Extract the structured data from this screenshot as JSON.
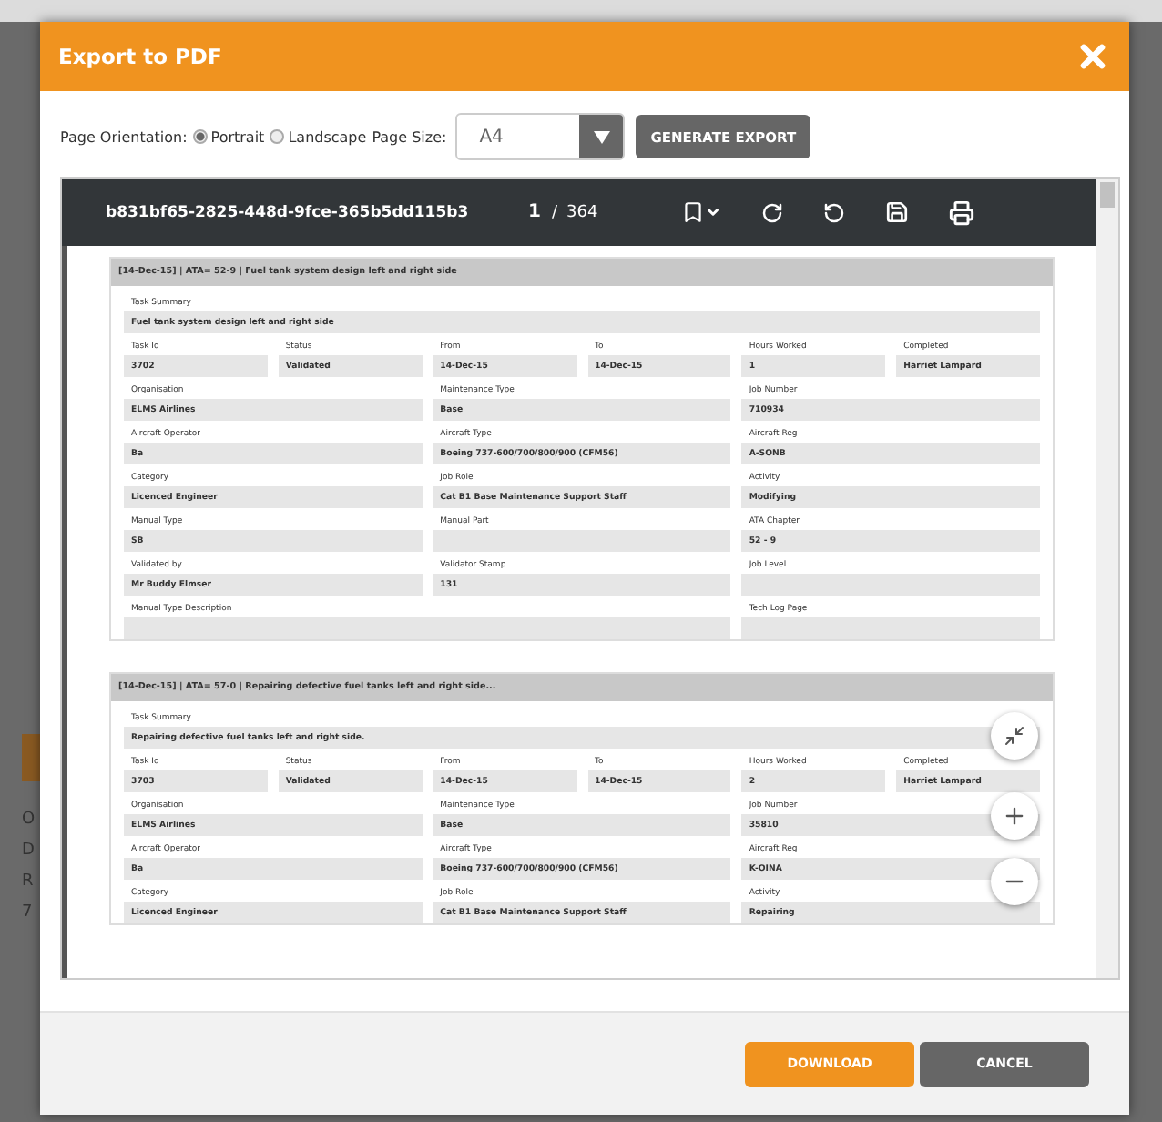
{
  "background_fragments": [
    "O",
    "D",
    "R",
    "7"
  ],
  "dialog": {
    "title": "Export to PDF"
  },
  "options": {
    "orientation_label": "Page Orientation:",
    "orientations": [
      {
        "label": "Portrait",
        "selected": true
      },
      {
        "label": "Landscape",
        "selected": false
      }
    ],
    "page_size_label": "Page Size:",
    "page_size": "A4",
    "generate_button": "GENERATE EXPORT"
  },
  "viewer": {
    "document_title": "b831bf65-2825-448d-9fce-365b5dd115b3",
    "page": "1",
    "separator": "/",
    "page_count": "364"
  },
  "records": [
    {
      "header": "[14-Dec-15] | ATA= 52-9 | Fuel tank system design left and right side",
      "rows": [
        {
          "kind": "full",
          "fields": [
            {
              "label": "Task Summary",
              "value": "Fuel tank system design left and right side"
            }
          ]
        },
        {
          "kind": "six",
          "fields": [
            {
              "label": "Task Id",
              "value": "3702"
            },
            {
              "label": "Status",
              "value": "Validated"
            },
            {
              "label": "From",
              "value": "14-Dec-15"
            },
            {
              "label": "To",
              "value": "14-Dec-15"
            },
            {
              "label": "Hours Worked",
              "value": "1"
            },
            {
              "label": "Completed",
              "value": "Harriet Lampard"
            }
          ]
        },
        {
          "kind": "three",
          "fields": [
            {
              "label": "Organisation",
              "value": "ELMS Airlines"
            },
            {
              "label": "Maintenance Type",
              "value": "Base"
            },
            {
              "label": "Job Number",
              "value": "710934"
            }
          ]
        },
        {
          "kind": "three",
          "fields": [
            {
              "label": "Aircraft Operator",
              "value": "Ba"
            },
            {
              "label": "Aircraft Type",
              "value": "Boeing 737-600/700/800/900 (CFM56)"
            },
            {
              "label": "Aircraft Reg",
              "value": "A-SONB"
            }
          ]
        },
        {
          "kind": "three",
          "fields": [
            {
              "label": "Category",
              "value": "Licenced Engineer"
            },
            {
              "label": "Job Role",
              "value": "Cat B1 Base Maintenance Support Staff"
            },
            {
              "label": "Activity",
              "value": "Modifying"
            }
          ]
        },
        {
          "kind": "three",
          "fields": [
            {
              "label": "Manual Type",
              "value": "SB"
            },
            {
              "label": "Manual Part"
            },
            {
              "label": "ATA Chapter",
              "value": "52 - 9"
            }
          ]
        },
        {
          "kind": "three",
          "fields": [
            {
              "label": "Validated by",
              "value": "Mr Buddy Elmser"
            },
            {
              "label": "Validator Stamp",
              "value": "131"
            },
            {
              "label": "Job Level"
            }
          ]
        },
        {
          "kind": "wide_narrow",
          "fields": [
            {
              "label": "Manual Type Description"
            },
            {
              "label": "Tech Log Page"
            }
          ]
        }
      ]
    },
    {
      "header": "[14-Dec-15] | ATA= 57-0 | Repairing defective fuel tanks left and right side...",
      "rows": [
        {
          "kind": "full",
          "fields": [
            {
              "label": "Task Summary",
              "value": "Repairing defective fuel tanks left and right side."
            }
          ]
        },
        {
          "kind": "six",
          "fields": [
            {
              "label": "Task Id",
              "value": "3703"
            },
            {
              "label": "Status",
              "value": "Validated"
            },
            {
              "label": "From",
              "value": "14-Dec-15"
            },
            {
              "label": "To",
              "value": "14-Dec-15"
            },
            {
              "label": "Hours Worked",
              "value": "2"
            },
            {
              "label": "Completed",
              "value": "Harriet Lampard"
            }
          ]
        },
        {
          "kind": "three",
          "fields": [
            {
              "label": "Organisation",
              "value": "ELMS Airlines"
            },
            {
              "label": "Maintenance Type",
              "value": "Base"
            },
            {
              "label": "Job Number",
              "value": "35810"
            }
          ]
        },
        {
          "kind": "three",
          "fields": [
            {
              "label": "Aircraft Operator",
              "value": "Ba"
            },
            {
              "label": "Aircraft Type",
              "value": "Boeing 737-600/700/800/900 (CFM56)"
            },
            {
              "label": "Aircraft Reg",
              "value": "K-OINA"
            }
          ]
        },
        {
          "kind": "three",
          "fields": [
            {
              "label": "Category",
              "value": "Licenced Engineer"
            },
            {
              "label": "Job Role",
              "value": "Cat B1 Base Maintenance Support Staff"
            },
            {
              "label": "Activity",
              "value": "Repairing"
            }
          ]
        }
      ]
    }
  ],
  "footer_buttons": [
    {
      "label": "DOWNLOAD",
      "kind": "primary"
    },
    {
      "label": "CANCEL",
      "kind": "secondary"
    }
  ]
}
